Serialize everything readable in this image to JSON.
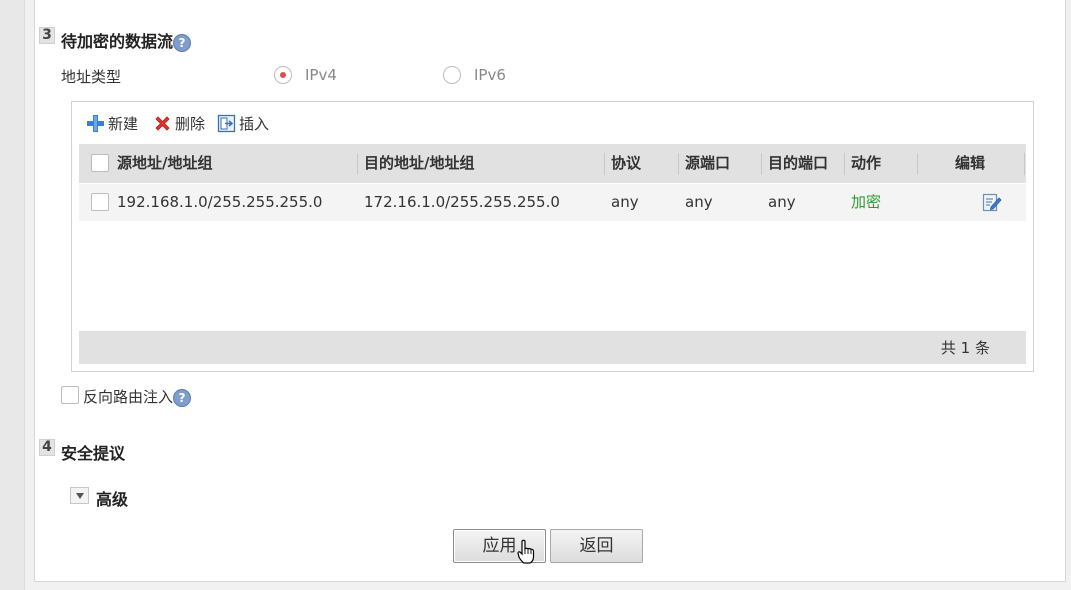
{
  "section3": {
    "number": "3",
    "title": "待加密的数据流",
    "address_type_label": "地址类型",
    "radio_ipv4": "IPv4",
    "radio_ipv6": "IPv6",
    "selected": "IPv4"
  },
  "toolbar": {
    "new_label": "新建",
    "delete_label": "删除",
    "insert_label": "插入"
  },
  "table": {
    "columns": [
      "源地址/地址组",
      "目的地址/地址组",
      "协议",
      "源端口",
      "目的端口",
      "动作",
      "编辑"
    ],
    "rows": [
      {
        "src": "192.168.1.0/255.255.255.0",
        "dst": "172.16.1.0/255.255.255.0",
        "protocol": "any",
        "src_port": "any",
        "dst_port": "any",
        "action": "加密",
        "edit_icon": "edit-icon"
      }
    ],
    "footer": "共 1 条"
  },
  "reverse_route": {
    "label": "反向路由注入",
    "checked": false
  },
  "section4": {
    "number": "4",
    "title": "安全提议"
  },
  "advanced": {
    "label": "高级"
  },
  "buttons": {
    "apply": "应用",
    "back": "返回"
  },
  "colors": {
    "action_green": "#2f9a2f",
    "radio_selected": "#e64b4b",
    "help_icon": "#7f9ecb"
  }
}
